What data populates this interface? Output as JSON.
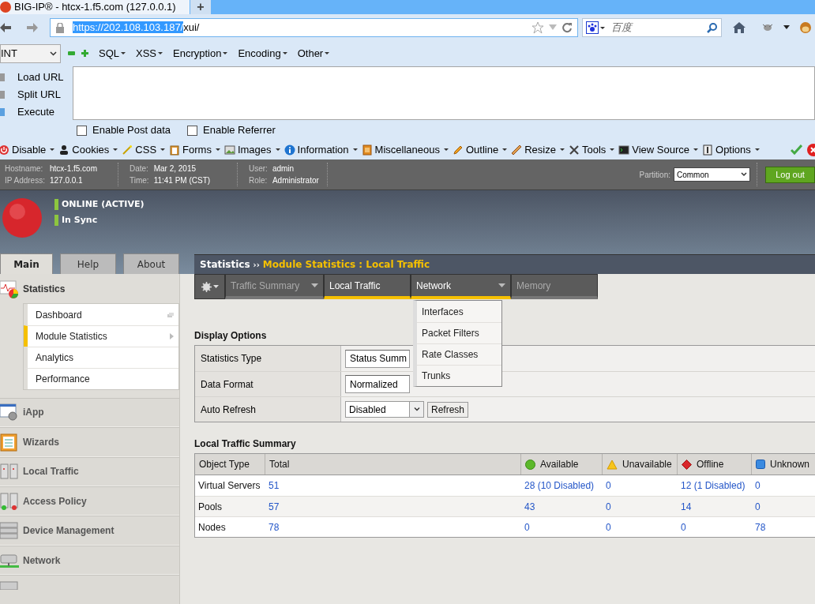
{
  "browser": {
    "tab": {
      "title": "BIG-IP® - htcx-1.f5.com (127.0.0.1)",
      "new_tab": "+"
    },
    "url": {
      "selected_part": "https://202.108.103.187/",
      "rest": "xui/"
    },
    "search": {
      "placeholder": "百度"
    }
  },
  "hackbar": {
    "select": "INT",
    "menus": [
      "SQL",
      "XSS",
      "Encryption",
      "Encoding",
      "Other"
    ],
    "actions": [
      "Load URL",
      "Split URL",
      "Execute"
    ],
    "options": [
      {
        "label": "Enable Post data",
        "checked": false
      },
      {
        "label": "Enable Referrer",
        "checked": false
      }
    ]
  },
  "webdev_toolbar": [
    "Disable",
    "Cookies",
    "CSS",
    "Forms",
    "Images",
    "Information",
    "Miscellaneous",
    "Outline",
    "Resize",
    "Tools",
    "View Source",
    "Options"
  ],
  "f5_header": {
    "fields": [
      {
        "label": "Hostname:",
        "value": "htcx-1.f5.com"
      },
      {
        "label": "IP Address:",
        "value": "127.0.0.1"
      },
      {
        "label": "Date:",
        "value": "Mar 2, 2015"
      },
      {
        "label": "Time:",
        "value": "11:41 PM (CST)"
      },
      {
        "label": "User:",
        "value": "admin"
      },
      {
        "label": "Role:",
        "value": "Administrator"
      }
    ],
    "partition": {
      "label": "Partition:",
      "value": "Common"
    },
    "logout": "Log out"
  },
  "status": [
    "ONLINE (ACTIVE)",
    "In Sync"
  ],
  "sidebar": {
    "tabs": [
      {
        "label": "Main",
        "selected": true
      },
      {
        "label": "Help",
        "selected": false
      },
      {
        "label": "About",
        "selected": false
      }
    ],
    "section": "Statistics",
    "items": [
      {
        "label": "Dashboard",
        "selected": false
      },
      {
        "label": "Module Statistics",
        "selected": true
      },
      {
        "label": "Analytics",
        "selected": false
      },
      {
        "label": "Performance",
        "selected": false
      }
    ],
    "modules": [
      "iApp",
      "Wizards",
      "Local Traffic",
      "Access Policy",
      "Device Management",
      "Network"
    ]
  },
  "breadcrumb": {
    "root": "Statistics",
    "sep": "››",
    "current": "Module Statistics : Local Traffic"
  },
  "subnav": [
    {
      "label": "Traffic Summary",
      "selected": false,
      "dim": true,
      "has_menu": true
    },
    {
      "label": "Local Traffic",
      "selected": true,
      "dim": false,
      "has_menu": false
    },
    {
      "label": "Network",
      "selected": true,
      "dim": false,
      "has_menu": true
    },
    {
      "label": "Memory",
      "selected": false,
      "dim": true,
      "has_menu": false
    }
  ],
  "network_menu": [
    "Interfaces",
    "Packet Filters",
    "Rate Classes",
    "Trunks"
  ],
  "display_options": {
    "title": "Display Options",
    "rows": [
      {
        "label": "Statistics Type",
        "value": "Status Summ",
        "kind": "covered"
      },
      {
        "label": "Data Format",
        "value": "Normalized",
        "kind": "covered"
      },
      {
        "label": "Auto Refresh",
        "value": "Disabled",
        "kind": "select",
        "button": "Refresh"
      }
    ]
  },
  "summary": {
    "title": "Local Traffic Summary",
    "columns": [
      {
        "label": "Object Type",
        "kind": "plain"
      },
      {
        "label": "Total",
        "kind": "plain"
      },
      {
        "label": "Available",
        "kind": "available"
      },
      {
        "label": "Unavailable",
        "kind": "unavailable"
      },
      {
        "label": "Offline",
        "kind": "offline"
      },
      {
        "label": "Unknown",
        "kind": "unknown"
      }
    ],
    "rows": [
      [
        "Virtual Servers",
        "51",
        "28 (10 Disabled)",
        "0",
        "12 (1 Disabled)",
        "0"
      ],
      [
        "Pools",
        "57",
        "43",
        "0",
        "14",
        "0"
      ],
      [
        "Nodes",
        "78",
        "0",
        "0",
        "0",
        "78"
      ]
    ]
  }
}
